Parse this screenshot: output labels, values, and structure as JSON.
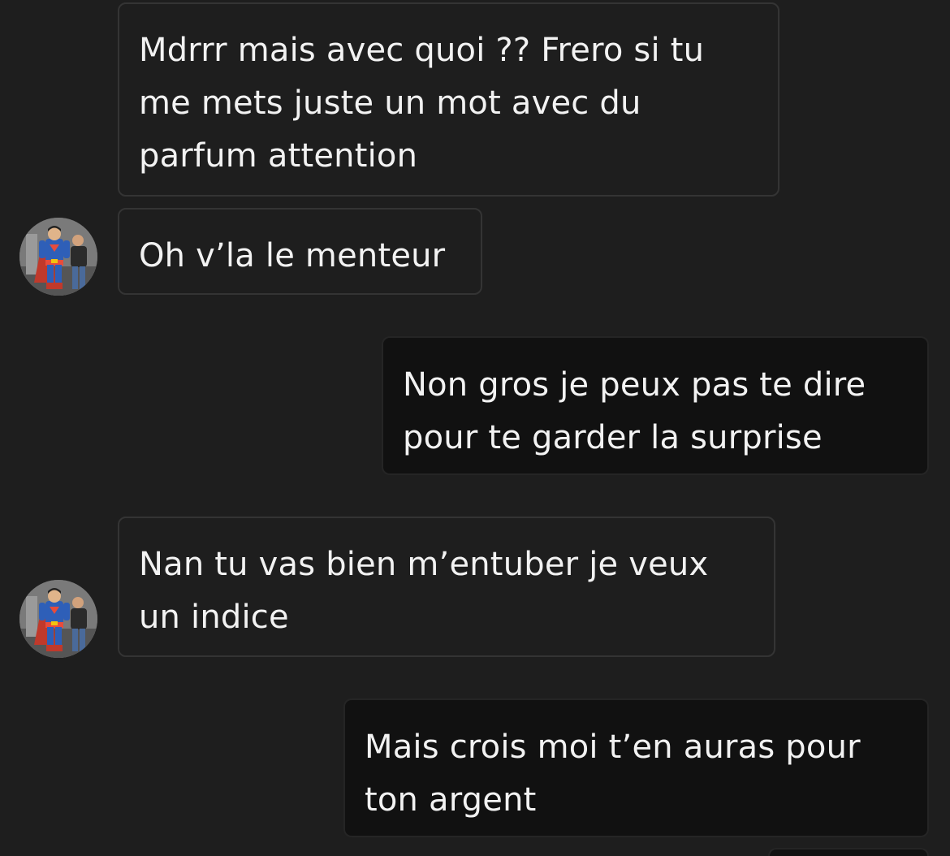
{
  "messages": [
    {
      "direction": "received",
      "text": "Mdrrr mais avec quoi ?? Frero si tu\nme mets juste un mot avec du\nparfum attention",
      "avatar": false
    },
    {
      "direction": "received",
      "text": "Oh v’la le menteur",
      "avatar": true
    },
    {
      "direction": "sent",
      "text": "Non gros je peux pas te dire\npour te garder la surprise"
    },
    {
      "direction": "received",
      "text": "Nan tu vas bien m’entuber je veux\nun indice",
      "avatar": true
    },
    {
      "direction": "sent",
      "text": "Mais crois moi t’en auras pour\nton argent"
    }
  ],
  "avatar_icon": "superhero-photo-avatar-icon"
}
